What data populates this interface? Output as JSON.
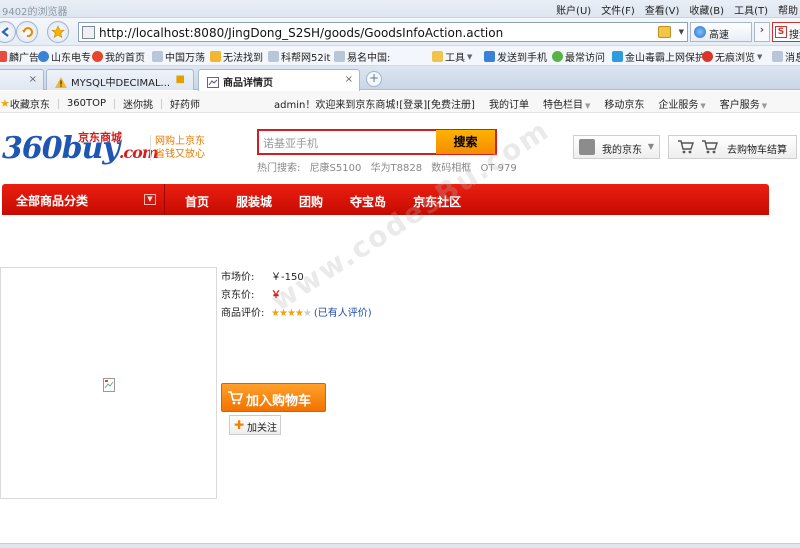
{
  "browser": {
    "window_title": "9402的浏览器",
    "menu": [
      "账户(U)",
      "文件(F)",
      "查看(V)",
      "收藏(B)",
      "工具(T)",
      "帮助"
    ],
    "address_url": "http://localhost:8080/JingDong_S2SH/goods/GoodsInfoAction.action",
    "speed_label": "高速",
    "search_engine_label": "搜狗",
    "favorites": [
      {
        "label": "麟广告",
        "icon": "ad-icon"
      },
      {
        "label": "山东电专",
        "icon": "globe-icon"
      },
      {
        "label": "我的首页",
        "icon": "weibo-icon"
      },
      {
        "label": "中国万荡",
        "icon": "page-icon"
      },
      {
        "label": "无法找到",
        "icon": "thumb-icon"
      },
      {
        "label": "科帮网52it",
        "icon": "page-icon"
      },
      {
        "label": "易名中国:",
        "icon": "page-icon"
      },
      {
        "label": "工具",
        "icon": "folder-icon"
      },
      {
        "label": "发送到手机",
        "icon": "phone-icon"
      },
      {
        "label": "最常访问",
        "icon": "green-icon"
      },
      {
        "label": "金山毒霸上网保护",
        "icon": "shield-icon"
      },
      {
        "label": "无痕浏览",
        "icon": "red-icon"
      },
      {
        "label": "消息",
        "icon": "page-icon"
      }
    ],
    "tabs": [
      {
        "label": "",
        "active": false
      },
      {
        "label": "MYSQL中DECIMAL...",
        "active": false
      },
      {
        "label": "商品详情页",
        "active": true
      }
    ]
  },
  "topnav": {
    "bookmark": "收藏京东",
    "top360": "360TOP",
    "miniprice": "迷你挑",
    "goodmed": "好药师",
    "welcome": "admin！欢迎来到京东商城!",
    "login": "[登录]",
    "register": "[免费注册]",
    "my_orders": "我的订单",
    "featured": "特色栏目",
    "mobile": "移动京东",
    "enterprise": "企业服务",
    "service": "客户服务"
  },
  "header": {
    "logo_main": "360buy",
    "logo_suffix": ".com",
    "logo_cn": "京东商城",
    "slogan_line1": "网购上京东",
    "slogan_line2": "省钱又放心",
    "search_placeholder": "诺基亚手机",
    "search_button": "搜索",
    "hot_label": "热门搜索:",
    "hot_words": [
      "尼康S5100",
      "华为T8828",
      "数码相框",
      "OT 979"
    ],
    "my_jd": "我的京东",
    "cart": "去购物车结算"
  },
  "mainnav": {
    "all_categories": "全部商品分类",
    "links": [
      "首页",
      "服装城",
      "团购",
      "夺宝岛",
      "京东社区"
    ]
  },
  "product": {
    "market_price_label": "市场价:",
    "market_price": "￥-150",
    "jd_price_label": "京东价:",
    "jd_price": "￥",
    "rating_label": "商品评价:",
    "rating_stars": 4,
    "rating_link": "(已有人评价)",
    "add_to_cart": "加入购物车",
    "follow": "加关注"
  },
  "watermark": "www.codesBu.com"
}
